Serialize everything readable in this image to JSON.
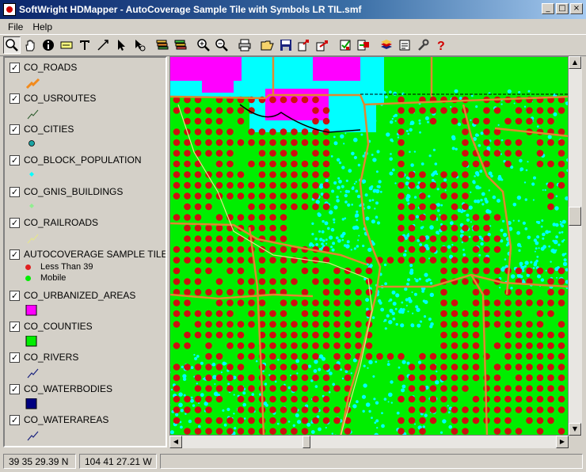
{
  "window": {
    "title": "SoftWright HDMapper - AutoCoverage Sample Tile with Symbols LR TIL.smf",
    "minimize": "_",
    "maximize": "□",
    "close": "×"
  },
  "menu": {
    "items": [
      "File",
      "Help"
    ]
  },
  "toolbar": {
    "buttons": [
      "zoom-select",
      "pan-hand",
      "info",
      "label",
      "text",
      "measure",
      "pointer",
      "select-feature",
      "layers-add",
      "layers-edit",
      "zoom-in",
      "zoom-out",
      "print",
      "open",
      "save",
      "export",
      "export-alt",
      "check-properties",
      "import",
      "stack",
      "notes",
      "wrench-settings",
      "help"
    ]
  },
  "legend": {
    "layers": [
      {
        "name": "CO_ROADS",
        "checked": true,
        "symbol": "road-line",
        "color": "#f28a1c"
      },
      {
        "name": "CO_USROUTES",
        "checked": true,
        "symbol": "thin-line",
        "color": "#2a5a2a"
      },
      {
        "name": "CO_CITIES",
        "checked": true,
        "symbol": "circle",
        "color": "#1aa3a3"
      },
      {
        "name": "CO_BLOCK_POPULATION",
        "checked": true,
        "symbol": "diamond",
        "color": "#00ffff"
      },
      {
        "name": "CO_GNIS_BUILDINGS",
        "checked": true,
        "symbol": "diamond",
        "color": "#90ee90"
      },
      {
        "name": "CO_RAILROADS",
        "checked": true,
        "symbol": "thin-line",
        "color": "#e6e68a"
      },
      {
        "name": "AUTOCOVERAGE SAMPLE TILE WIT",
        "checked": true,
        "symbol": "none",
        "color": ""
      },
      {
        "name": "CO_URBANIZED_AREAS",
        "checked": true,
        "symbol": "square",
        "color": "#ff00ff"
      },
      {
        "name": "CO_COUNTIES",
        "checked": true,
        "symbol": "square",
        "color": "#00ee00"
      },
      {
        "name": "CO_RIVERS",
        "checked": true,
        "symbol": "thin-line",
        "color": "#1a237e"
      },
      {
        "name": "CO_WATERBODIES",
        "checked": true,
        "symbol": "square",
        "color": "#000080"
      },
      {
        "name": "CO_WATERAREAS",
        "checked": true,
        "symbol": "thin-line",
        "color": "#1a237e"
      }
    ],
    "coverage_items": [
      {
        "label": "Less Than 39",
        "color": "#e02020"
      },
      {
        "label": "Mobile",
        "color": "#00ee00"
      }
    ]
  },
  "status": {
    "latitude": "39 35 29.39 N",
    "longitude": "104 41 27.21 W"
  },
  "colors": {
    "map_green": "#00ee00",
    "dot_red": "#cc1010",
    "cyan": "#00ffff",
    "magenta": "#ff00ff",
    "road": "#e08830"
  }
}
